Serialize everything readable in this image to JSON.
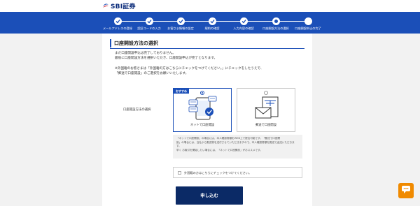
{
  "brand": {
    "name": "SBI証券"
  },
  "steps": [
    {
      "label": "メールアドレスの登録",
      "state": "done"
    },
    {
      "label": "認証コードの入力",
      "state": "done"
    },
    {
      "label": "お客さま情報の設定",
      "state": "done"
    },
    {
      "label": "規約の確認",
      "state": "done"
    },
    {
      "label": "入力内容の確認",
      "state": "done"
    },
    {
      "label": "口座開設方法の選択",
      "state": "current"
    },
    {
      "label": "口座開設申込の完了",
      "state": "todo"
    }
  ],
  "page": {
    "title": "口座開設方法の選択",
    "intro_line1": "まだ口座開設申込は完了しておりません。",
    "intro_line2": "最後に口座開設方法を選択いただき、口座開設申込が完了となります。",
    "note_line1": "※外国籍のお客さまは「外国籍の方はこちらにチェックをつけてください。」にチェックをしたうえで、",
    "note_line2": "「郵送で口座開設」のご選択をお願いいたします。"
  },
  "method": {
    "field_label": "口座開設方法の選択",
    "options": [
      {
        "label": "ネットで口座開設",
        "badge": "おすすめ",
        "selected": true
      },
      {
        "label": "郵送で口座開設",
        "badge": "",
        "selected": false
      }
    ],
    "info_line1": "「ネットで口座開設」の場合には、本人確認書類をWEB上で提出可能です。「郵送で口座開",
    "info_line2": "設」の場合には、当社から郵送物を送付させていただきますので、本人確認書類を郵送で返送いただきます。",
    "info_line3": "早く お取引を開始したい場合には、「ネットで口座開設」がおススメです。"
  },
  "foreign_check": {
    "label": "外国籍の方はこちらにチェックをつけてください。",
    "checked": false
  },
  "submit_label": "申し込む",
  "help": {
    "icon": "chat-help-icon"
  },
  "colors": {
    "accent": "#1b4fb8",
    "button": "#0b2a66",
    "help": "#f08a00"
  }
}
